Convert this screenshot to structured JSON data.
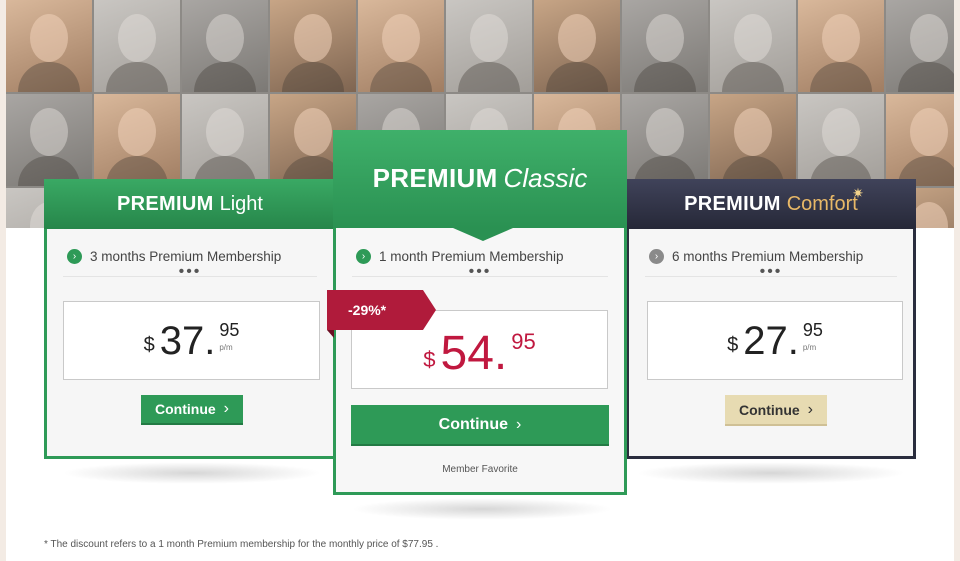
{
  "plans": [
    {
      "id": "light",
      "title_bold": "PREMIUM",
      "title_rest": "Light",
      "feature": "3 months Premium Membership",
      "currency": "$",
      "price_main": "37.",
      "price_cents": "95",
      "per": "p/m",
      "cta": "Continue"
    },
    {
      "id": "classic",
      "title_bold": "PREMIUM",
      "title_rest": "Classic",
      "feature": "1 month Premium Membership",
      "discount": "-29%*",
      "currency": "$",
      "price_main": "54.",
      "price_cents": "95",
      "cta": "Continue",
      "badge": "Member Favorite"
    },
    {
      "id": "comfort",
      "title_bold": "PREMIUM",
      "title_rest": "Comfort",
      "feature": "6 months Premium Membership",
      "currency": "$",
      "price_main": "27.",
      "price_cents": "95",
      "per": "p/m",
      "cta": "Continue"
    }
  ],
  "feature_more": "•••",
  "footnote": "* The discount refers to a 1 month Premium membership for the monthly price of $77.95 .",
  "colors": {
    "green": "#2e9a57",
    "dark": "#2a2d3e",
    "accent_red": "#c0183f",
    "comfort_gold": "#e8b867",
    "comfort_button": "#e7dbb2"
  },
  "icons": {
    "feature_check": "chevron-right-circle-icon",
    "button_arrow": "chevron-right-icon",
    "comfort_sparkle": "sparkle-icon"
  }
}
